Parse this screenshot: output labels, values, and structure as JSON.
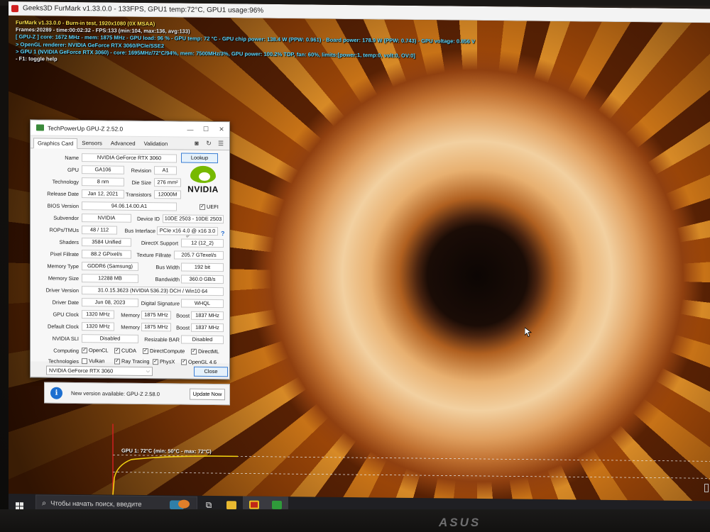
{
  "furmark": {
    "window_title": "Geeks3D FurMark v1.33.0.0 - 133FPS, GPU1 temp:72°C, GPU1 usage:96%",
    "osd": [
      {
        "text": "FurMark v1.33.0.0 - Burn-in test, 1920x1080 (0X MSAA)",
        "color": "yellow"
      },
      {
        "text": "Frames:20289 - time:00:02:32 - FPS:133 (min:104, max:136, avg:133)",
        "color": "white"
      },
      {
        "text": "[ GPU-Z ] core: 1672 MHz - mem: 1875 MHz - GPU load: 96 % - GPU temp: 72 °C - GPU chip power: 138.4 W (PPW: 0.961) - Board power: 178.9 W (PPW: 0.743) - GPU voltage: 0.856 V",
        "color": "cyan"
      },
      {
        "text": "> OpenGL renderer: NVIDIA GeForce RTX 3060/PCIe/SSE2",
        "color": "cyan"
      },
      {
        "text": "> GPU 1 (NVIDIA GeForce RTX 3060) - core: 1695MHz/72°C/94%, mem: 7500MHz/3%, GPU power: 100.2% TDP, fan: 60%, limits:[power:1, temp:0, volt:0, OV:0]",
        "color": "cyan"
      },
      {
        "text": "- F1: toggle help",
        "color": "white"
      }
    ],
    "temp_graph_label": "GPU 1: 72°C (min: 50°C - max: 72°C)"
  },
  "gpuz": {
    "title": "TechPowerUp GPU-Z 2.52.0",
    "tabs": [
      "Graphics Card",
      "Sensors",
      "Advanced",
      "Validation"
    ],
    "lookup_label": "Lookup",
    "logo_text": "NVIDIA",
    "uefi_label": "UEFI",
    "fields": {
      "name_label": "Name",
      "name": "NVIDIA GeForce RTX 3060",
      "gpu_label": "GPU",
      "gpu": "GA106",
      "revision_label": "Revision",
      "revision": "A1",
      "technology_label": "Technology",
      "technology": "8 nm",
      "die_size_label": "Die Size",
      "die_size": "276 mm²",
      "release_date_label": "Release Date",
      "release_date": "Jan 12, 2021",
      "transistors_label": "Transistors",
      "transistors": "12000M",
      "bios_label": "BIOS Version",
      "bios": "94.06.14.00.A1",
      "subvendor_label": "Subvendor",
      "subvendor": "NVIDIA",
      "device_id_label": "Device ID",
      "device_id": "10DE 2503 - 10DE 2503",
      "rops_label": "ROPs/TMUs",
      "rops": "48 / 112",
      "bus_label": "Bus Interface",
      "bus": "PCIe x16 4.0 @ x16 3.0",
      "shaders_label": "Shaders",
      "shaders": "3584 Unified",
      "directx_label": "DirectX Support",
      "directx": "12 (12_2)",
      "pixel_label": "Pixel Fillrate",
      "pixel": "88.2 GPixel/s",
      "texture_label": "Texture Fillrate",
      "texture": "205.7 GTexel/s",
      "mem_type_label": "Memory Type",
      "mem_type": "GDDR6 (Samsung)",
      "bus_width_label": "Bus Width",
      "bus_width": "192 bit",
      "mem_size_label": "Memory Size",
      "mem_size": "12288 MB",
      "bandwidth_label": "Bandwidth",
      "bandwidth": "360.0 GB/s",
      "driver_version_label": "Driver Version",
      "driver_version": "31.0.15.3623 (NVIDIA 536.23) DCH / Win10 64",
      "driver_date_label": "Driver Date",
      "driver_date": "Jun 08, 2023",
      "signature_label": "Digital Signature",
      "signature": "WHQL",
      "gpu_clock_label": "GPU Clock",
      "gpu_clock": "1320 MHz",
      "memory_label": "Memory",
      "memory_clock": "1875 MHz",
      "boost_label": "Boost",
      "boost": "1837 MHz",
      "default_clock_label": "Default Clock",
      "default_clock": "1320 MHz",
      "default_memory": "1875 MHz",
      "default_boost": "1837 MHz",
      "sli_label": "NVIDIA SLI",
      "sli": "Disabled",
      "rebar_label": "Resizable BAR",
      "rebar": "Disabled",
      "computing_label": "Computing",
      "technologies_label": "Technologies"
    },
    "computing": [
      "OpenCL",
      "CUDA",
      "DirectCompute",
      "DirectML"
    ],
    "technologies": [
      "Vulkan",
      "Ray Tracing",
      "PhysX",
      "OpenGL 4.6"
    ],
    "technologies_checked": [
      false,
      true,
      true,
      true
    ],
    "selected_gpu": "NVIDIA GeForce RTX 3060",
    "close_label": "Close"
  },
  "notification": {
    "text": "New version available: GPU-Z 2.58.0",
    "button": "Update Now"
  },
  "taskbar": {
    "search_placeholder": "Чтобы начать поиск, введите"
  },
  "monitor_brand": "ASUS"
}
